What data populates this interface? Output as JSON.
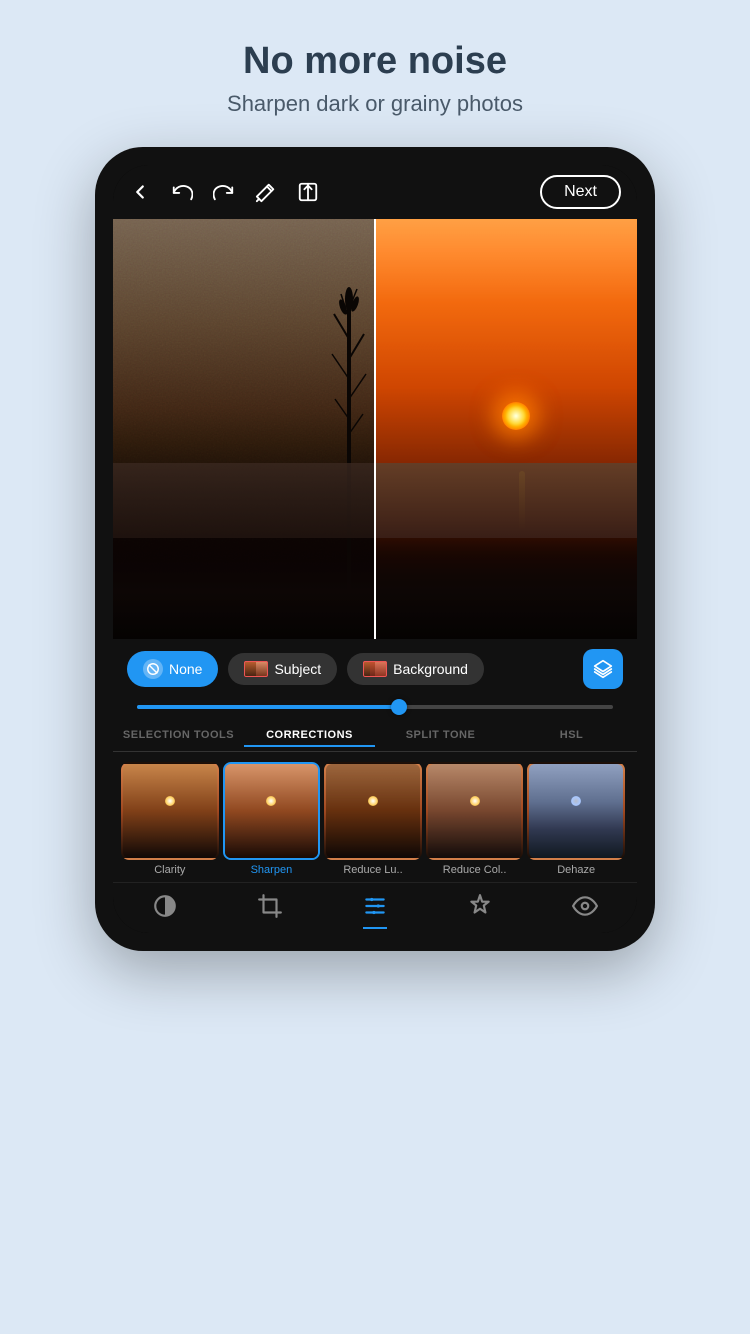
{
  "header": {
    "title": "No more noise",
    "subtitle": "Sharpen dark or grainy photos"
  },
  "toolbar": {
    "back_icon": "←",
    "undo_icon": "↺",
    "redo_icon": "↻",
    "magic_icon": "✦",
    "compare_icon": "⊟",
    "next_label": "Next"
  },
  "selection_bar": {
    "none_label": "None",
    "subject_label": "Subject",
    "background_label": "Background"
  },
  "tabs": [
    {
      "id": "selection-tools",
      "label": "SELECTION TOOLS",
      "active": false
    },
    {
      "id": "corrections",
      "label": "CORRECTIONS",
      "active": true
    },
    {
      "id": "split-tone",
      "label": "SPLIT TONE",
      "active": false
    },
    {
      "id": "hsl",
      "label": "HSL",
      "active": false
    }
  ],
  "tools": [
    {
      "id": "clarity",
      "label": "Clarity",
      "active": false
    },
    {
      "id": "sharpen",
      "label": "Sharpen",
      "active": true
    },
    {
      "id": "reduce-luminance",
      "label": "Reduce Lu..",
      "active": false
    },
    {
      "id": "reduce-color",
      "label": "Reduce Col..",
      "active": false
    },
    {
      "id": "dehaze",
      "label": "Dehaze",
      "active": false
    }
  ],
  "bottom_nav": [
    {
      "id": "circle-half",
      "icon": "circle-half",
      "active": false
    },
    {
      "id": "crop",
      "icon": "crop",
      "active": false
    },
    {
      "id": "sliders",
      "icon": "sliders",
      "active": true
    },
    {
      "id": "bandage",
      "icon": "bandage",
      "active": false
    },
    {
      "id": "eye",
      "icon": "eye",
      "active": false
    }
  ]
}
